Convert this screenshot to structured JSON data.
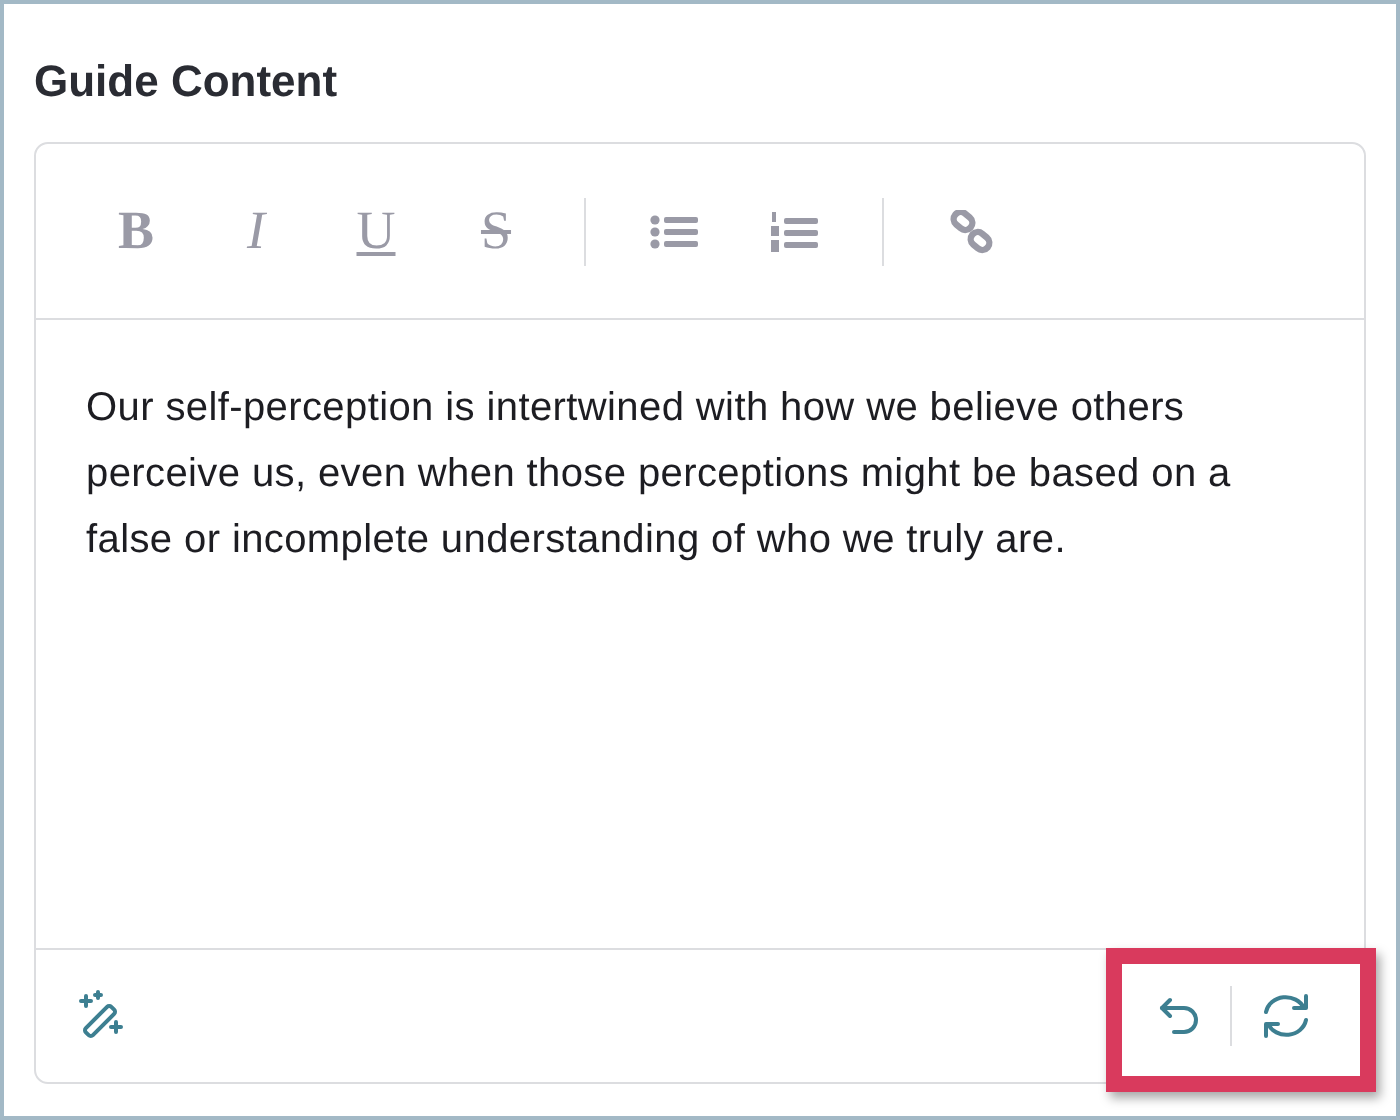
{
  "title": "Guide Content",
  "toolbar": [
    {
      "kind": "bold",
      "label": "B"
    },
    {
      "kind": "italic",
      "label": "I"
    },
    {
      "kind": "underline",
      "label": "U"
    },
    {
      "kind": "strike",
      "label": "S"
    },
    {
      "kind": "divider"
    },
    {
      "kind": "bullets"
    },
    {
      "kind": "numbers"
    },
    {
      "kind": "divider"
    },
    {
      "kind": "link"
    }
  ],
  "body": "Our self-perception is intertwined with how we believe others perceive us, even when those perceptions might be based on a false or incomplete understanding of who we truly are.",
  "footer": {
    "actions_highlighted": true
  }
}
